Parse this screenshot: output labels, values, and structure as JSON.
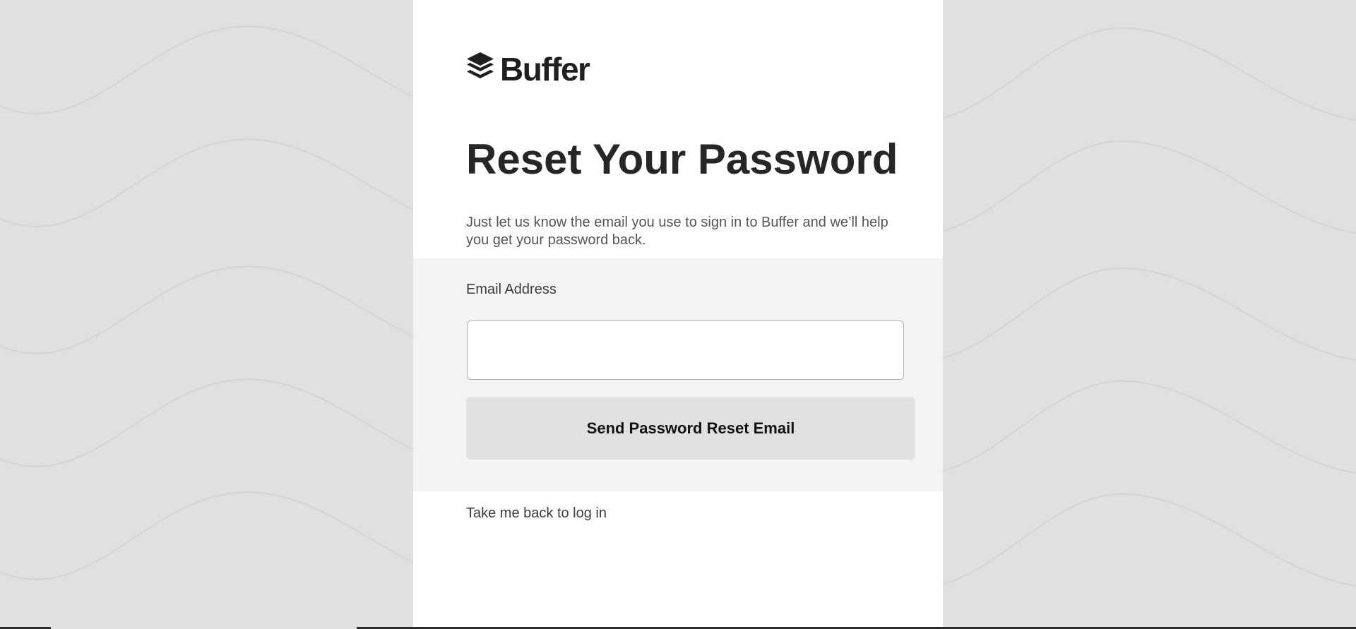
{
  "brand": {
    "name": "Buffer",
    "logo_icon": "buffer-layers-icon",
    "text_color": "#1f1f1f"
  },
  "page": {
    "title": "Reset Your Password",
    "subtitle": "Just let us know the email you use to sign in to Buffer and we’ll help you get your password back."
  },
  "form": {
    "email_label": "Email Address",
    "email_value": "",
    "email_placeholder": "",
    "submit_label": "Send Password Reset Email"
  },
  "links": {
    "back_to_login": "Take me back to log in"
  },
  "colors": {
    "page_background": "#e0e0e0",
    "panel_background": "#ffffff",
    "form_background": "#f3f3f3",
    "button_background": "#e0e0e0",
    "heading": "#262626",
    "body_text": "#555555"
  }
}
